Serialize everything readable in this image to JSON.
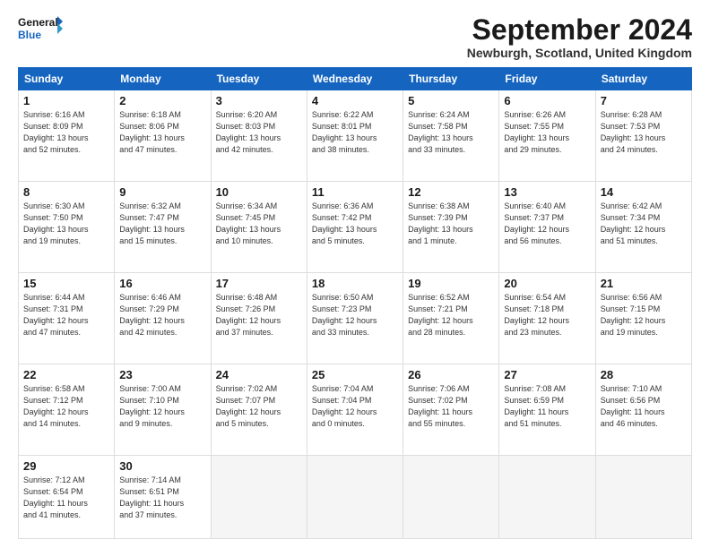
{
  "header": {
    "logo_line1": "General",
    "logo_line2": "Blue",
    "month_title": "September 2024",
    "location": "Newburgh, Scotland, United Kingdom"
  },
  "calendar": {
    "days_of_week": [
      "Sunday",
      "Monday",
      "Tuesday",
      "Wednesday",
      "Thursday",
      "Friday",
      "Saturday"
    ],
    "weeks": [
      [
        {
          "day": "1",
          "info": "Sunrise: 6:16 AM\nSunset: 8:09 PM\nDaylight: 13 hours\nand 52 minutes."
        },
        {
          "day": "2",
          "info": "Sunrise: 6:18 AM\nSunset: 8:06 PM\nDaylight: 13 hours\nand 47 minutes."
        },
        {
          "day": "3",
          "info": "Sunrise: 6:20 AM\nSunset: 8:03 PM\nDaylight: 13 hours\nand 42 minutes."
        },
        {
          "day": "4",
          "info": "Sunrise: 6:22 AM\nSunset: 8:01 PM\nDaylight: 13 hours\nand 38 minutes."
        },
        {
          "day": "5",
          "info": "Sunrise: 6:24 AM\nSunset: 7:58 PM\nDaylight: 13 hours\nand 33 minutes."
        },
        {
          "day": "6",
          "info": "Sunrise: 6:26 AM\nSunset: 7:55 PM\nDaylight: 13 hours\nand 29 minutes."
        },
        {
          "day": "7",
          "info": "Sunrise: 6:28 AM\nSunset: 7:53 PM\nDaylight: 13 hours\nand 24 minutes."
        }
      ],
      [
        {
          "day": "8",
          "info": "Sunrise: 6:30 AM\nSunset: 7:50 PM\nDaylight: 13 hours\nand 19 minutes."
        },
        {
          "day": "9",
          "info": "Sunrise: 6:32 AM\nSunset: 7:47 PM\nDaylight: 13 hours\nand 15 minutes."
        },
        {
          "day": "10",
          "info": "Sunrise: 6:34 AM\nSunset: 7:45 PM\nDaylight: 13 hours\nand 10 minutes."
        },
        {
          "day": "11",
          "info": "Sunrise: 6:36 AM\nSunset: 7:42 PM\nDaylight: 13 hours\nand 5 minutes."
        },
        {
          "day": "12",
          "info": "Sunrise: 6:38 AM\nSunset: 7:39 PM\nDaylight: 13 hours\nand 1 minute."
        },
        {
          "day": "13",
          "info": "Sunrise: 6:40 AM\nSunset: 7:37 PM\nDaylight: 12 hours\nand 56 minutes."
        },
        {
          "day": "14",
          "info": "Sunrise: 6:42 AM\nSunset: 7:34 PM\nDaylight: 12 hours\nand 51 minutes."
        }
      ],
      [
        {
          "day": "15",
          "info": "Sunrise: 6:44 AM\nSunset: 7:31 PM\nDaylight: 12 hours\nand 47 minutes."
        },
        {
          "day": "16",
          "info": "Sunrise: 6:46 AM\nSunset: 7:29 PM\nDaylight: 12 hours\nand 42 minutes."
        },
        {
          "day": "17",
          "info": "Sunrise: 6:48 AM\nSunset: 7:26 PM\nDaylight: 12 hours\nand 37 minutes."
        },
        {
          "day": "18",
          "info": "Sunrise: 6:50 AM\nSunset: 7:23 PM\nDaylight: 12 hours\nand 33 minutes."
        },
        {
          "day": "19",
          "info": "Sunrise: 6:52 AM\nSunset: 7:21 PM\nDaylight: 12 hours\nand 28 minutes."
        },
        {
          "day": "20",
          "info": "Sunrise: 6:54 AM\nSunset: 7:18 PM\nDaylight: 12 hours\nand 23 minutes."
        },
        {
          "day": "21",
          "info": "Sunrise: 6:56 AM\nSunset: 7:15 PM\nDaylight: 12 hours\nand 19 minutes."
        }
      ],
      [
        {
          "day": "22",
          "info": "Sunrise: 6:58 AM\nSunset: 7:12 PM\nDaylight: 12 hours\nand 14 minutes."
        },
        {
          "day": "23",
          "info": "Sunrise: 7:00 AM\nSunset: 7:10 PM\nDaylight: 12 hours\nand 9 minutes."
        },
        {
          "day": "24",
          "info": "Sunrise: 7:02 AM\nSunset: 7:07 PM\nDaylight: 12 hours\nand 5 minutes."
        },
        {
          "day": "25",
          "info": "Sunrise: 7:04 AM\nSunset: 7:04 PM\nDaylight: 12 hours\nand 0 minutes."
        },
        {
          "day": "26",
          "info": "Sunrise: 7:06 AM\nSunset: 7:02 PM\nDaylight: 11 hours\nand 55 minutes."
        },
        {
          "day": "27",
          "info": "Sunrise: 7:08 AM\nSunset: 6:59 PM\nDaylight: 11 hours\nand 51 minutes."
        },
        {
          "day": "28",
          "info": "Sunrise: 7:10 AM\nSunset: 6:56 PM\nDaylight: 11 hours\nand 46 minutes."
        }
      ],
      [
        {
          "day": "29",
          "info": "Sunrise: 7:12 AM\nSunset: 6:54 PM\nDaylight: 11 hours\nand 41 minutes."
        },
        {
          "day": "30",
          "info": "Sunrise: 7:14 AM\nSunset: 6:51 PM\nDaylight: 11 hours\nand 37 minutes."
        },
        {
          "day": "",
          "info": ""
        },
        {
          "day": "",
          "info": ""
        },
        {
          "day": "",
          "info": ""
        },
        {
          "day": "",
          "info": ""
        },
        {
          "day": "",
          "info": ""
        }
      ]
    ]
  }
}
